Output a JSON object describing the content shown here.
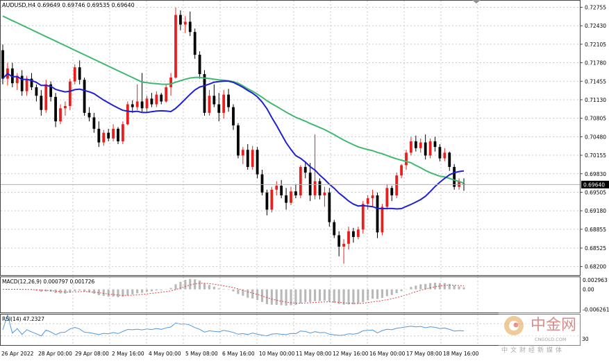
{
  "window": {
    "header_text": "AUDUSD,H4  0.69649 0.69746 0.69535 0.69640",
    "current_price_label": "0.69640"
  },
  "colors": {
    "bull_candle": "#e8201d",
    "bear_candle": "#000000",
    "ma_fast": "#1f1fd6",
    "ma_slow": "#3fb870",
    "macd_hist": "#b8b8b8",
    "macd_signal": "#e23b3b",
    "rsi_line": "#4f98dc",
    "grid": "#c9c9c9"
  },
  "chart_data": [
    {
      "type": "candlestick",
      "symbol": "AUDUSD",
      "timeframe": "H4",
      "ohlc_current": {
        "open": 0.69649,
        "high": 0.69746,
        "low": 0.69535,
        "close": 0.6964
      },
      "y_ticks": [
        "0.72755",
        "0.72430",
        "0.72105",
        "0.71780",
        "0.71455",
        "0.71130",
        "0.70805",
        "0.70480",
        "0.70155",
        "0.69830",
        "0.69505",
        "0.69180",
        "0.68855",
        "0.68525",
        "0.68200"
      ],
      "ylim": [
        0.6805,
        0.7287
      ],
      "x_ticks": [
        "26 Apr 2022",
        "28 Apr 00:00",
        "29 Apr 08:00",
        "2 May 16:00",
        "4 May 00:00",
        "5 May 08:00",
        "6 May 16:00",
        "10 May 00:00",
        "11 May 08:00",
        "12 May 16:00",
        "16 May 00:00",
        "17 May 08:00",
        "18 May 16:00"
      ],
      "candles": [
        [
          0.72,
          0.721,
          0.714,
          0.715
        ],
        [
          0.715,
          0.7178,
          0.7138,
          0.7168
        ],
        [
          0.7168,
          0.7178,
          0.7135,
          0.7142
        ],
        [
          0.7142,
          0.716,
          0.713,
          0.7155
        ],
        [
          0.7155,
          0.7165,
          0.712,
          0.7128
        ],
        [
          0.7128,
          0.7155,
          0.712,
          0.715
        ],
        [
          0.715,
          0.716,
          0.713,
          0.7135
        ],
        [
          0.7135,
          0.714,
          0.711,
          0.712
        ],
        [
          0.712,
          0.713,
          0.7085,
          0.7095
        ],
        [
          0.7095,
          0.7148,
          0.709,
          0.714
        ],
        [
          0.714,
          0.7145,
          0.711,
          0.7118
        ],
        [
          0.7118,
          0.7125,
          0.7065,
          0.7075
        ],
        [
          0.7075,
          0.7105,
          0.707,
          0.7098
        ],
        [
          0.7098,
          0.711,
          0.7085,
          0.7102
        ],
        [
          0.7102,
          0.715,
          0.7095,
          0.7145
        ],
        [
          0.7145,
          0.7175,
          0.714,
          0.717
        ],
        [
          0.717,
          0.7182,
          0.714,
          0.7148
        ],
        [
          0.7148,
          0.7152,
          0.7085,
          0.709
        ],
        [
          0.709,
          0.71,
          0.7075,
          0.7082
        ],
        [
          0.7082,
          0.709,
          0.7055,
          0.7062
        ],
        [
          0.7062,
          0.7075,
          0.703,
          0.7038
        ],
        [
          0.7038,
          0.706,
          0.7032,
          0.7055
        ],
        [
          0.7055,
          0.7062,
          0.704,
          0.7045
        ],
        [
          0.7045,
          0.707,
          0.704,
          0.7062
        ],
        [
          0.7062,
          0.7065,
          0.7035,
          0.704
        ],
        [
          0.704,
          0.7075,
          0.7035,
          0.707
        ],
        [
          0.707,
          0.711,
          0.7068,
          0.7105
        ],
        [
          0.7105,
          0.7112,
          0.709,
          0.71
        ],
        [
          0.71,
          0.714,
          0.7095,
          0.711
        ],
        [
          0.711,
          0.716,
          0.7092,
          0.7098
        ],
        [
          0.7098,
          0.712,
          0.709,
          0.7115
        ],
        [
          0.7115,
          0.7125,
          0.71,
          0.7105
        ],
        [
          0.7105,
          0.7128,
          0.71,
          0.7122
        ],
        [
          0.7122,
          0.7125,
          0.7105,
          0.711
        ],
        [
          0.711,
          0.714,
          0.7108,
          0.7135
        ],
        [
          0.7135,
          0.716,
          0.712,
          0.7152
        ],
        [
          0.7152,
          0.7275,
          0.715,
          0.7262
        ],
        [
          0.7262,
          0.727,
          0.7235,
          0.7245
        ],
        [
          0.7245,
          0.726,
          0.723,
          0.725
        ],
        [
          0.725,
          0.7268,
          0.7225,
          0.7232
        ],
        [
          0.7232,
          0.7238,
          0.7185,
          0.7192
        ],
        [
          0.7192,
          0.7198,
          0.715,
          0.7158
        ],
        [
          0.7158,
          0.7165,
          0.7085,
          0.709
        ],
        [
          0.709,
          0.713,
          0.7085,
          0.712
        ],
        [
          0.712,
          0.714,
          0.71,
          0.7105
        ],
        [
          0.7105,
          0.7125,
          0.7075,
          0.709
        ],
        [
          0.709,
          0.713,
          0.708,
          0.7122
        ],
        [
          0.7122,
          0.7132,
          0.7092,
          0.71
        ],
        [
          0.71,
          0.7105,
          0.706,
          0.7068
        ],
        [
          0.7068,
          0.7072,
          0.701,
          0.7015
        ],
        [
          0.7015,
          0.703,
          0.7,
          0.7025
        ],
        [
          0.7025,
          0.7035,
          0.699,
          0.6995
        ],
        [
          0.6995,
          0.7032,
          0.699,
          0.7025
        ],
        [
          0.7025,
          0.703,
          0.6975,
          0.6982
        ],
        [
          0.6982,
          0.699,
          0.6945,
          0.695
        ],
        [
          0.695,
          0.6955,
          0.691,
          0.692
        ],
        [
          0.692,
          0.696,
          0.6915,
          0.6955
        ],
        [
          0.6955,
          0.697,
          0.6945,
          0.6962
        ],
        [
          0.6962,
          0.6972,
          0.694,
          0.6945
        ],
        [
          0.6945,
          0.6958,
          0.692,
          0.6932
        ],
        [
          0.6932,
          0.696,
          0.6928,
          0.6952
        ],
        [
          0.6952,
          0.6965,
          0.694,
          0.6945
        ],
        [
          0.6945,
          0.6998,
          0.694,
          0.6995
        ],
        [
          0.6995,
          0.7005,
          0.6975,
          0.6985
        ],
        [
          0.6985,
          0.7002,
          0.6935,
          0.6945
        ],
        [
          0.6945,
          0.7052,
          0.6938,
          0.697
        ],
        [
          0.697,
          0.6975,
          0.6938,
          0.6945
        ],
        [
          0.6945,
          0.696,
          0.6925,
          0.695
        ],
        [
          0.695,
          0.6958,
          0.689,
          0.6898
        ],
        [
          0.6898,
          0.6902,
          0.687,
          0.6875
        ],
        [
          0.6875,
          0.6882,
          0.6838,
          0.6855
        ],
        [
          0.6855,
          0.6868,
          0.6825,
          0.686
        ],
        [
          0.686,
          0.689,
          0.685,
          0.6882
        ],
        [
          0.6882,
          0.6888,
          0.6862,
          0.6872
        ],
        [
          0.6872,
          0.689,
          0.6868,
          0.6885
        ],
        [
          0.6885,
          0.6935,
          0.6878,
          0.693
        ],
        [
          0.693,
          0.6945,
          0.692,
          0.694
        ],
        [
          0.694,
          0.6955,
          0.6925,
          0.6945
        ],
        [
          0.6945,
          0.695,
          0.687,
          0.688
        ],
        [
          0.688,
          0.693,
          0.6875,
          0.6925
        ],
        [
          0.6925,
          0.6965,
          0.692,
          0.6958
        ],
        [
          0.6958,
          0.6962,
          0.6935,
          0.6945
        ],
        [
          0.6945,
          0.6985,
          0.694,
          0.698
        ],
        [
          0.698,
          0.7,
          0.6975,
          0.6998
        ],
        [
          0.6998,
          0.7025,
          0.699,
          0.702
        ],
        [
          0.702,
          0.7048,
          0.7015,
          0.704
        ],
        [
          0.704,
          0.705,
          0.7022,
          0.7028
        ],
        [
          0.7028,
          0.7045,
          0.702,
          0.7038
        ],
        [
          0.7038,
          0.7052,
          0.7008,
          0.7015
        ],
        [
          0.7015,
          0.7045,
          0.701,
          0.704
        ],
        [
          0.704,
          0.7048,
          0.7022,
          0.703
        ],
        [
          0.703,
          0.7035,
          0.7005,
          0.701
        ],
        [
          0.701,
          0.7028,
          0.7005,
          0.702
        ],
        [
          0.702,
          0.7022,
          0.6988,
          0.6995
        ],
        [
          0.6995,
          0.7,
          0.6955,
          0.696
        ],
        [
          0.696,
          0.6975,
          0.6955,
          0.697
        ],
        [
          0.6965,
          0.6975,
          0.6953,
          0.6964
        ]
      ],
      "ma_fast_name": "",
      "ma_slow_name": ""
    },
    {
      "type": "macd",
      "label": "MACD(12,26,9) 0.000797 0.001726",
      "y_ticks": [
        "0.002963",
        "0.00",
        "-0.006261"
      ],
      "ylim": [
        -0.0072,
        0.0038
      ]
    },
    {
      "type": "rsi",
      "label": "RSI(14) 47.2327",
      "ylim": [
        0,
        100
      ],
      "levels": [
        30,
        70
      ]
    }
  ],
  "watermark": {
    "brand_cn": "中金网",
    "brand_en": "CNGOLD.COM",
    "tagline_cn": "中文财经新媒体",
    "rsi_axis_hint": "30"
  }
}
